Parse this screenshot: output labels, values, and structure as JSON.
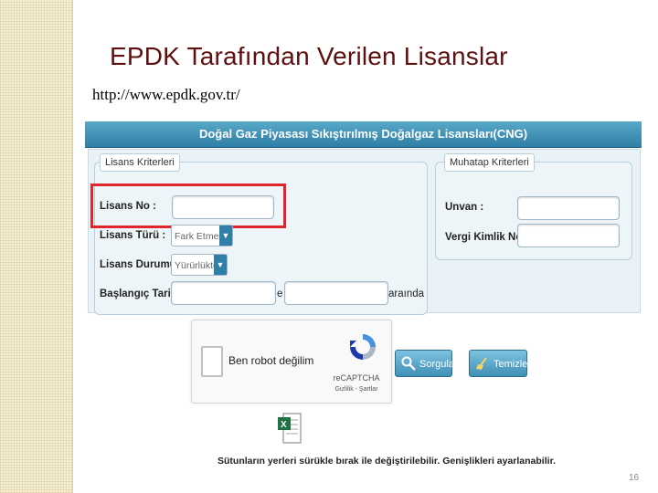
{
  "slide": {
    "title": "EPDK Tarafından Verilen Lisanslar",
    "url": "http://www.epdk.gov.tr/",
    "page_number": "16"
  },
  "form": {
    "header": "Doğal Gaz Piyasası Sıkıştırılmış Doğalgaz Lisansları(CNG)",
    "license_section": {
      "legend": "Lisans Kriterleri",
      "license_no_label": "Lisans No :",
      "license_no_value": "",
      "license_type_label": "Lisans Türü :",
      "license_type_value": "Fark Etmez",
      "license_status_label": "Lisans Durumu :",
      "license_status_value": "Yürürlükte",
      "start_date_label": "Başlangıç Tarihi :",
      "start_date_from": "",
      "start_date_to": "",
      "between_word": "e",
      "range_suffix": "araında"
    },
    "party_section": {
      "legend": "Muhatap Kriterleri",
      "title_label": "Unvan :",
      "title_value": "",
      "tax_id_label": "Vergi Kimlik No :",
      "tax_id_value": ""
    },
    "captcha": {
      "text": "Ben robot değilim",
      "brand": "reCAPTCHA",
      "links": "Gizlilik - Şartlar"
    },
    "buttons": {
      "query": "Sorgula",
      "clear": "Temizle"
    },
    "footer_note": "Sütunların yerleri sürükle bırak ile değiştirilebilir. Genişlikleri ayarlanabilir.",
    "highlight_color": "#e0262b"
  }
}
